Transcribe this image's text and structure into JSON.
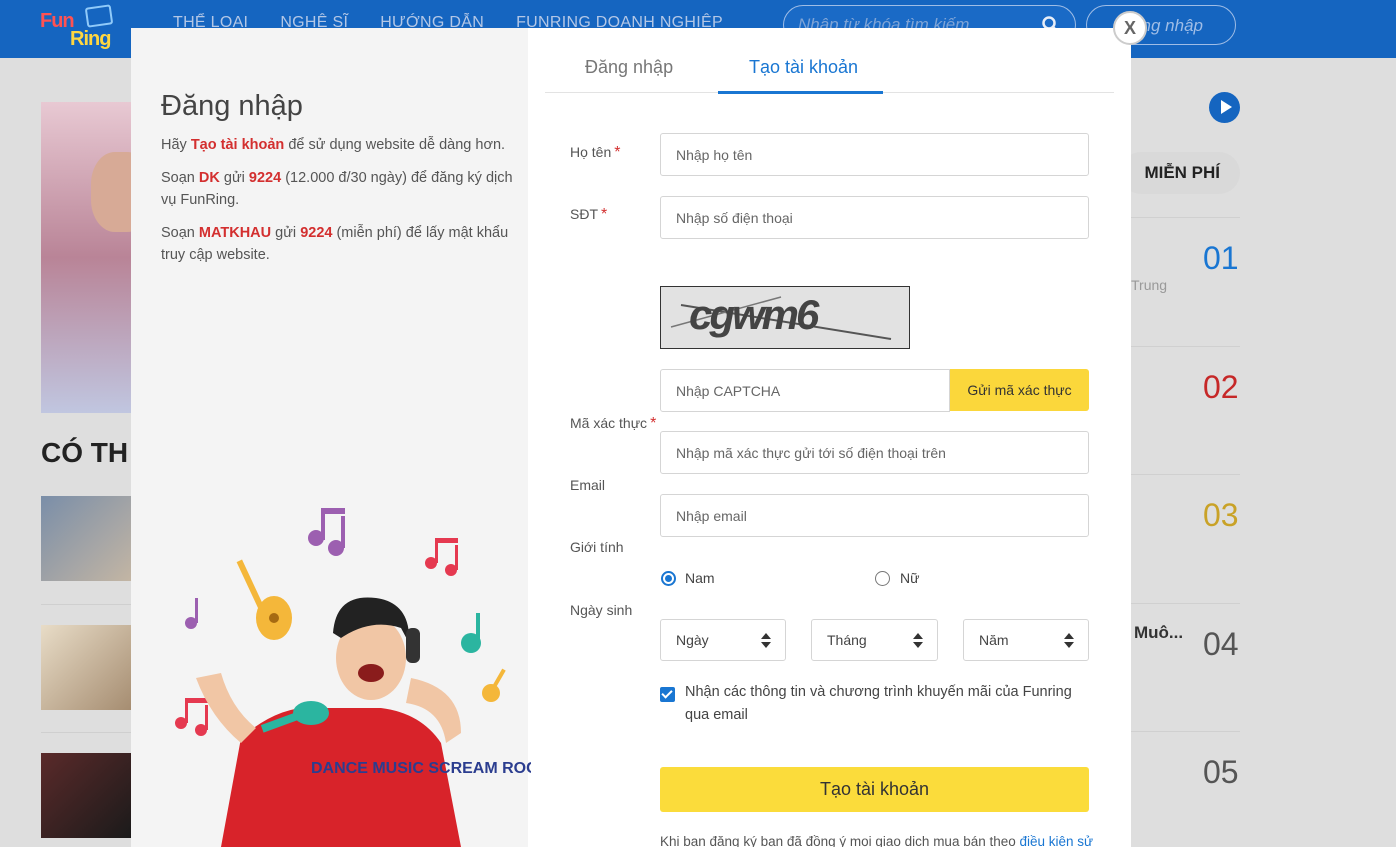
{
  "header": {
    "logo": "FunRing",
    "nav": [
      "Thể loại",
      "Nghệ sĩ",
      "Hướng dẫn",
      "FunRing doanh nghiệp"
    ],
    "search_placeholder": "Nhập từ khóa tìm kiếm",
    "login_button": "Đăng nhập"
  },
  "background": {
    "section_title": "CÓ TH",
    "free_label": "MIỄN PHÍ",
    "ranks": [
      "01",
      "02",
      "03",
      "04",
      "05"
    ],
    "rank_colors": [
      "#1976d2",
      "#c62828",
      "#c9a227",
      "#555555",
      "#555555"
    ],
    "rank1_artist": "Trung",
    "rank4_title": "Muô..."
  },
  "modal": {
    "close_label": "X",
    "left": {
      "title": "Đăng nhập",
      "p1_prefix": "Hãy ",
      "p1_link": "Tạo tài khoản",
      "p1_suffix": " để sử dụng website dễ dàng hơn.",
      "p2_a": "Soạn ",
      "p2_code": "DK",
      "p2_b": " gửi ",
      "p2_num": "9224",
      "p2_c": " (12.000 đ/30 ngày) để đăng ký dịch vụ FunRing.",
      "p3_a": "Soạn ",
      "p3_code": "MATKHAU",
      "p3_b": " gửi ",
      "p3_num": "9224",
      "p3_c": " (miễn phí) để lấy mật khẩu truy cập website.",
      "shirt_text": "DANCE MUSIC SCREAM ROCK"
    },
    "tabs": {
      "login": "Đăng nhập",
      "create": "Tạo tài khoản"
    },
    "form": {
      "name_label": "Họ tên",
      "name_placeholder": "Nhập họ tên",
      "phone_label": "SĐT",
      "phone_placeholder": "Nhập số điện thoại",
      "captcha_text": "cgwm6",
      "captcha_placeholder": "Nhập CAPTCHA",
      "send_code_button": "Gửi mã xác thực",
      "otp_label": "Mã xác thực",
      "otp_placeholder": "Nhập mã xác thực gửi tới số điện thoại trên",
      "email_label": "Email",
      "email_placeholder": "Nhập email",
      "gender_label": "Giới tính",
      "gender_male": "Nam",
      "gender_female": "Nữ",
      "gender_selected": "Nam",
      "dob_label": "Ngày sinh",
      "day": "Ngày",
      "month": "Tháng",
      "year": "Năm",
      "promo_checked": true,
      "promo_label": "Nhận các thông tin và chương trình khuyến mãi của Funring qua email",
      "submit_button": "Tạo tài khoản",
      "terms_text": "Khi bạn đăng ký bạn đã đồng ý mọi giao dịch mua bán theo ",
      "terms_link": "điều kiện sử dụng và chính sách của Funring"
    }
  },
  "colors": {
    "brand_blue": "#1565c0",
    "accent_yellow": "#fbd73b",
    "required_red": "#d32f2f",
    "link_blue": "#1976d2"
  }
}
